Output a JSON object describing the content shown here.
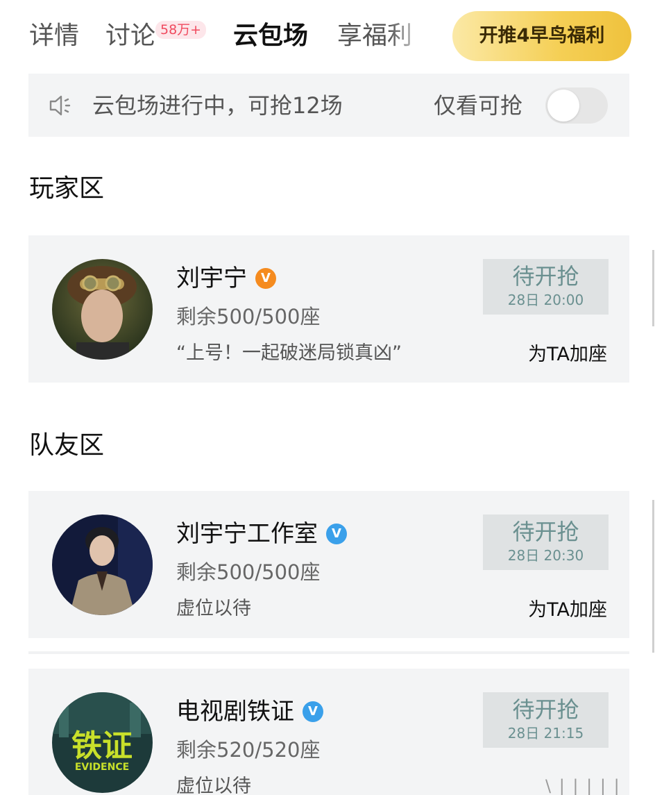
{
  "tabs": [
    {
      "label": "详情",
      "active": false
    },
    {
      "label": "讨论",
      "active": false,
      "badge": "58万+"
    },
    {
      "label": "云包场",
      "active": true
    },
    {
      "label": "享福利",
      "active": false
    }
  ],
  "promo_button": "开推4早鸟福利",
  "notice": {
    "icon": "speaker-icon",
    "text": "云包场进行中，可抢12场",
    "filter_label": "仅看可抢",
    "filter_on": false
  },
  "sections": [
    {
      "title": "玩家区",
      "cards": [
        {
          "name": "刘宇宁",
          "verified": "orange",
          "seats": "剩余500/500座",
          "slogan": "“上号！一起破迷局锁真凶”",
          "button_label": "待开抢",
          "button_time": "28日 20:00",
          "add_seat": "为TA加座"
        }
      ]
    },
    {
      "title": "队友区",
      "cards": [
        {
          "name": "刘宇宁工作室",
          "verified": "blue",
          "seats": "剩余500/500座",
          "slogan": "虚位以待",
          "button_label": "待开抢",
          "button_time": "28日 20:30",
          "add_seat": "为TA加座"
        },
        {
          "name": "电视剧铁证",
          "verified": "blue",
          "seats": "剩余520/520座",
          "slogan": "虚位以待",
          "button_label": "待开抢",
          "button_time": "28日 21:15",
          "avatar_text": "铁证",
          "avatar_subtext": "EVIDENCE"
        }
      ]
    }
  ],
  "colors": {
    "accent_gold": "#f5cf55",
    "verified_orange": "#f58b1f",
    "verified_blue": "#3aa0ea",
    "button_text": "#6a9090"
  },
  "watermark": "\\ | | | | |"
}
